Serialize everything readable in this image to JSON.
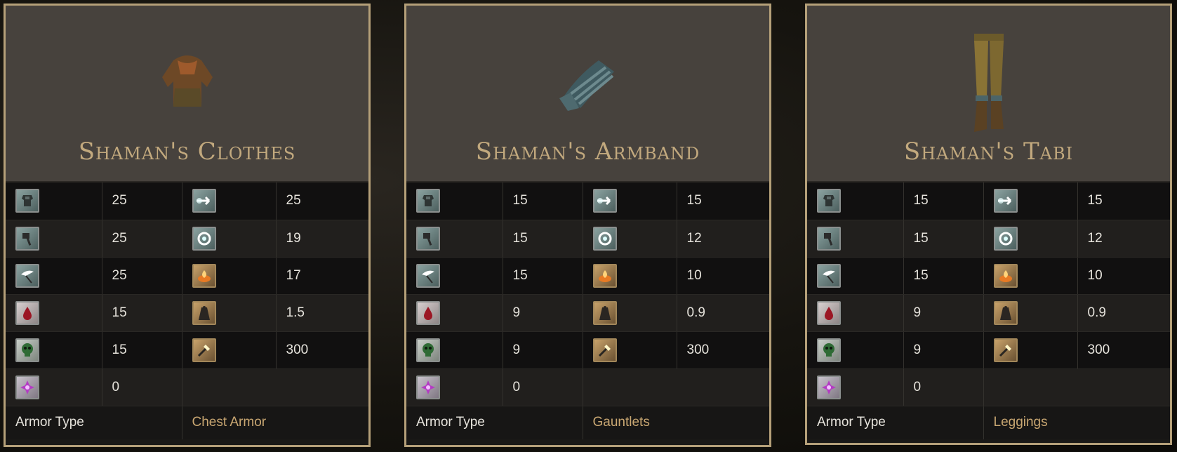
{
  "cards": [
    {
      "name": "Shaman's Clothes",
      "item_icon": "chest-armor-image",
      "stats": [
        {
          "left_icon": "physical-defense-icon",
          "left_value": "25",
          "right_icon": "pierce-defense-icon",
          "right_value": "25"
        },
        {
          "left_icon": "blunt-defense-icon",
          "left_value": "25",
          "right_icon": "magic-defense-icon",
          "right_value": "19"
        },
        {
          "left_icon": "slash-defense-icon",
          "left_value": "25",
          "right_icon": "fire-defense-icon",
          "right_value": "17"
        },
        {
          "left_icon": "bleed-resistance-icon",
          "left_value": "15",
          "right_icon": "weight-icon",
          "right_value": "1.5"
        },
        {
          "left_icon": "poison-resistance-icon",
          "left_value": "15",
          "right_icon": "durability-icon",
          "right_value": "300"
        },
        {
          "left_icon": "curse-resistance-icon",
          "left_value": "0"
        }
      ],
      "footer_label": "Armor Type",
      "footer_value": "Chest Armor"
    },
    {
      "name": "Shaman's Armband",
      "item_icon": "gauntlets-image",
      "stats": [
        {
          "left_icon": "physical-defense-icon",
          "left_value": "15",
          "right_icon": "pierce-defense-icon",
          "right_value": "15"
        },
        {
          "left_icon": "blunt-defense-icon",
          "left_value": "15",
          "right_icon": "magic-defense-icon",
          "right_value": "12"
        },
        {
          "left_icon": "slash-defense-icon",
          "left_value": "15",
          "right_icon": "fire-defense-icon",
          "right_value": "10"
        },
        {
          "left_icon": "bleed-resistance-icon",
          "left_value": "9",
          "right_icon": "weight-icon",
          "right_value": "0.9"
        },
        {
          "left_icon": "poison-resistance-icon",
          "left_value": "9",
          "right_icon": "durability-icon",
          "right_value": "300"
        },
        {
          "left_icon": "curse-resistance-icon",
          "left_value": "0"
        }
      ],
      "footer_label": "Armor Type",
      "footer_value": "Gauntlets"
    },
    {
      "name": "Shaman's Tabi",
      "item_icon": "leggings-image",
      "stats": [
        {
          "left_icon": "physical-defense-icon",
          "left_value": "15",
          "right_icon": "pierce-defense-icon",
          "right_value": "15"
        },
        {
          "left_icon": "blunt-defense-icon",
          "left_value": "15",
          "right_icon": "magic-defense-icon",
          "right_value": "12"
        },
        {
          "left_icon": "slash-defense-icon",
          "left_value": "15",
          "right_icon": "fire-defense-icon",
          "right_value": "10"
        },
        {
          "left_icon": "bleed-resistance-icon",
          "left_value": "9",
          "right_icon": "weight-icon",
          "right_value": "0.9"
        },
        {
          "left_icon": "poison-resistance-icon",
          "left_value": "9",
          "right_icon": "durability-icon",
          "right_value": "300"
        },
        {
          "left_icon": "curse-resistance-icon",
          "left_value": "0"
        }
      ],
      "footer_label": "Armor Type",
      "footer_value": "Leggings"
    }
  ],
  "colors": {
    "frame_gold": "#b5a079",
    "title_gold": "#c2a97e",
    "footer_value": "#c9a772",
    "header_bg": "#47423d"
  }
}
